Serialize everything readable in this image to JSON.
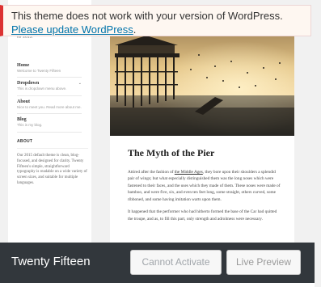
{
  "notice": {
    "message": "This theme does not work with your version of WordPress.",
    "link_text": "Please update WordPress",
    "trailing": "."
  },
  "preview": {
    "sidebar": {
      "tagline": "for 2015.",
      "menu": [
        {
          "label": "Home",
          "description": "Welcome to Twenty Fifteen"
        },
        {
          "label": "Dropdown",
          "description": "This is dropdown menu above."
        },
        {
          "label": "About",
          "description": "Nice to meet you. Read more about me."
        },
        {
          "label": "Blog",
          "description": "This is my blog."
        }
      ],
      "about_title": "ABOUT",
      "about_text": "Our 2015 default theme is clean, blog-focused, and designed for clarity. Twenty Fifteen's simple, straightforward typography is readable on a wide variety of screen sizes, and suitable for multiple languages."
    },
    "post": {
      "title": "The Myth of the Pier",
      "p1_before": "Attired after the fashion of ",
      "p1_link": "the Middle Ages",
      "p1_after": ", they bore upon their shoulders a splendid pair of wings; but what especially distinguished them was the long noses which were fastened to their faces, and the uses which they made of them. These noses were made of bamboo, and were five, six, and even ten feet long, some straight, others curved, some ribboned, and some having imitation warts upon them.",
      "p2": "It happened that the performer who had hitherto formed the base of the Car had quitted the troupe, and as, to fill this part, only strength and adroitness were necessary."
    }
  },
  "footer": {
    "theme_name": "Twenty Fifteen",
    "activate_label": "Cannot Activate",
    "preview_label": "Live Preview"
  },
  "colors": {
    "notice_border": "#dc3232",
    "link": "#0073aa",
    "footer_bg": "#32373c"
  }
}
